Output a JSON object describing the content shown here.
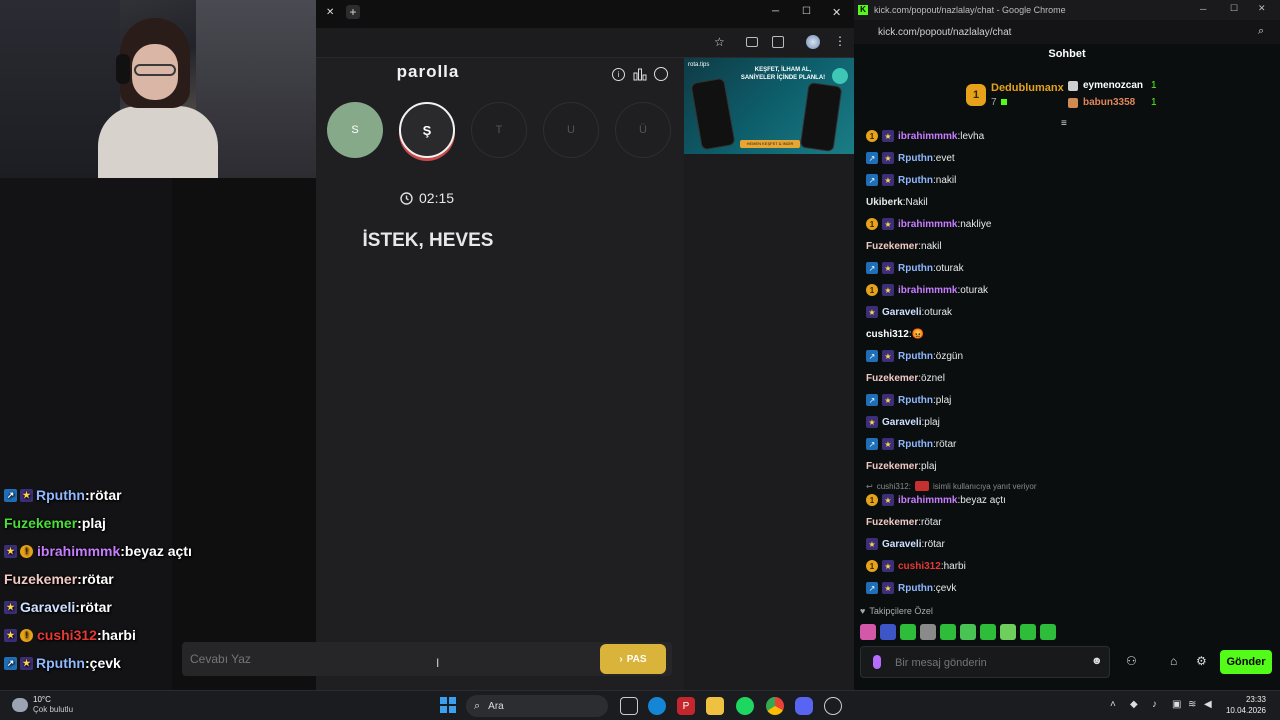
{
  "overlay_chat": [
    {
      "badges": [
        "blue",
        "star"
      ],
      "user": "Rputhn",
      "color": "#8fb8ff",
      "msg": "rötar"
    },
    {
      "badges": [],
      "user": "Fuzekemer",
      "color": "#4ade3a",
      "msg": "plaj"
    },
    {
      "badges": [
        "star",
        "gold"
      ],
      "user": "ibrahimmmk",
      "color": "#c77dff",
      "msg": "beyaz açtı"
    },
    {
      "badges": [],
      "user": "Fuzekemer",
      "color": "#f0c9c4",
      "msg": "rötar"
    },
    {
      "badges": [
        "star"
      ],
      "user": "Garaveli",
      "color": "#cfe0ff",
      "msg": "rötar"
    },
    {
      "badges": [
        "star",
        "gold"
      ],
      "user": "cushi312",
      "color": "#e53935",
      "msg": "harbi"
    },
    {
      "badges": [
        "blue",
        "star"
      ],
      "user": "Rputhn",
      "color": "#8fb8ff",
      "msg": "çevk"
    }
  ],
  "browser": {
    "close_glyph": "✕",
    "new_tab_glyph": "+",
    "win_min": "─",
    "win_max": "☐",
    "win_close": "✕"
  },
  "parolla": {
    "title": "parolla",
    "letters": [
      {
        "char": "S",
        "state": "done"
      },
      {
        "char": "Ş",
        "state": "active"
      },
      {
        "char": "T",
        "state": "pending"
      },
      {
        "char": "U",
        "state": "pending"
      },
      {
        "char": "Ü",
        "state": "pending"
      }
    ],
    "timer": "02:15",
    "clue": "İSTEK, HEVES",
    "input_placeholder": "Cevabı Yaz",
    "pass_label": "PAS",
    "accent": "#d9b33a",
    "done_color": "#86a98a"
  },
  "ad": {
    "brand": "rota.tips",
    "headline": "KEŞFET, İLHAM AL, SANİYELER İÇİNDE PLANLA!",
    "cta": "HEMEN KEŞFET & İNDİR"
  },
  "kick": {
    "window_title": "kick.com/popout/nazlalay/chat - Google Chrome",
    "url": "kick.com/popout/nazlalay/chat",
    "header": "Sohbet",
    "top_gifters": [
      {
        "rank": "1",
        "user": "Dedublumanx",
        "count": "7"
      },
      {
        "rank": "2",
        "user": "eymenozcan",
        "count": "1"
      },
      {
        "rank": "3",
        "user": "babun3358",
        "count": "1"
      }
    ],
    "messages": [
      {
        "badges": [
          "gold",
          "star"
        ],
        "user": "ibrahimmmk",
        "color": "#c77dff",
        "msg": "levha"
      },
      {
        "badges": [
          "blue",
          "star"
        ],
        "user": "Rputhn",
        "color": "#8fb8ff",
        "msg": "evet"
      },
      {
        "badges": [
          "blue",
          "star"
        ],
        "user": "Rputhn",
        "color": "#8fb8ff",
        "msg": "nakil"
      },
      {
        "badges": [],
        "user": "Ukiberk",
        "color": "#e8e8e8",
        "msg": "Nakil"
      },
      {
        "badges": [
          "gold",
          "star"
        ],
        "user": "ibrahimmmk",
        "color": "#c77dff",
        "msg": "nakliye"
      },
      {
        "badges": [],
        "user": "Fuzekemer",
        "color": "#f0c9c4",
        "msg": "nakil"
      },
      {
        "badges": [
          "blue",
          "star"
        ],
        "user": "Rputhn",
        "color": "#8fb8ff",
        "msg": "oturak"
      },
      {
        "badges": [
          "gold",
          "star"
        ],
        "user": "ibrahimmmk",
        "color": "#c77dff",
        "msg": "oturak"
      },
      {
        "badges": [
          "star"
        ],
        "user": "Garaveli",
        "color": "#cfe0ff",
        "msg": "oturak"
      },
      {
        "badges": [],
        "user": "cushi312",
        "color": "#ffffff",
        "msg": "😡"
      },
      {
        "badges": [
          "blue",
          "star"
        ],
        "user": "Rputhn",
        "color": "#8fb8ff",
        "msg": "özgün"
      },
      {
        "badges": [],
        "user": "Fuzekemer",
        "color": "#f0c9c4",
        "msg": "öznel"
      },
      {
        "badges": [
          "blue",
          "star"
        ],
        "user": "Rputhn",
        "color": "#8fb8ff",
        "msg": "plaj"
      },
      {
        "badges": [
          "star"
        ],
        "user": "Garaveli",
        "color": "#cfe0ff",
        "msg": "plaj"
      },
      {
        "badges": [
          "blue",
          "star"
        ],
        "user": "Rputhn",
        "color": "#8fb8ff",
        "msg": "rötar"
      },
      {
        "badges": [],
        "user": "Fuzekemer",
        "color": "#f0c9c4",
        "msg": "plaj"
      }
    ],
    "reply_hint": {
      "user": "cushi312:",
      "text": "isimli kullanıcıya yanıt veriyor"
    },
    "messages_after": [
      {
        "badges": [
          "gold",
          "star"
        ],
        "user": "ibrahimmmk",
        "color": "#c77dff",
        "msg": "beyaz açtı"
      },
      {
        "badges": [],
        "user": "Fuzekemer",
        "color": "#f0c9c4",
        "msg": "rötar"
      },
      {
        "badges": [
          "star"
        ],
        "user": "Garaveli",
        "color": "#cfe0ff",
        "msg": "rötar"
      },
      {
        "badges": [
          "gold",
          "star"
        ],
        "user": "cushi312",
        "color": "#e53935",
        "msg": "harbi"
      },
      {
        "badges": [
          "blue",
          "star"
        ],
        "user": "Rputhn",
        "color": "#8fb8ff",
        "msg": "çevk"
      }
    ],
    "followers_only": "Takipçilere Özel",
    "input_placeholder": "Bir mesaj gönderin",
    "send_label": "Gönder",
    "accent": "#53fc18"
  },
  "taskbar": {
    "temp": "10°C",
    "weather": "Çok bulutlu",
    "search_label": "Ara",
    "time": "23:33",
    "date": "10.04.2026"
  }
}
